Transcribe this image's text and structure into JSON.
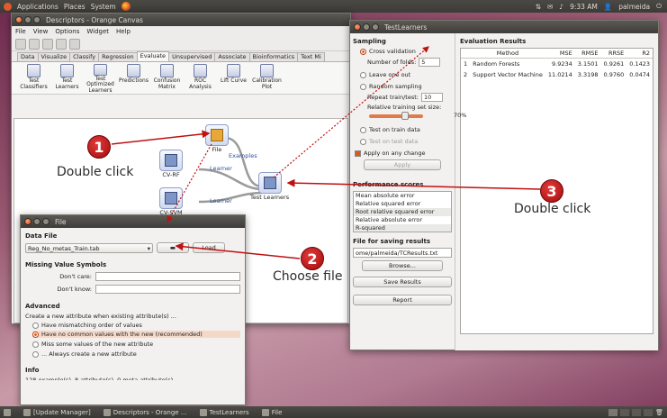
{
  "topbar": {
    "menus": [
      "Applications",
      "Places",
      "System"
    ],
    "time": "9:33 AM",
    "user": "palmeida"
  },
  "canvas_window": {
    "title": "Descriptors - Orange Canvas",
    "menus": [
      "File",
      "View",
      "Options",
      "Widget",
      "Help"
    ],
    "tabs": [
      "Data",
      "Visualize",
      "Classify",
      "Regression",
      "Evaluate",
      "Unsupervised",
      "Associate",
      "Bioinformatics",
      "Text Mi"
    ],
    "active_tab": "Evaluate",
    "widgets": [
      {
        "label": "Test Classifiers",
        "icon": "test-classifiers-icon"
      },
      {
        "label": "Test Learners",
        "icon": "test-learners-icon"
      },
      {
        "label": "Test Optimized Learners",
        "icon": "test-optimized-icon"
      },
      {
        "label": "Predictions",
        "icon": "predictions-icon"
      },
      {
        "label": "Confusion Matrix",
        "icon": "confusion-matrix-icon"
      },
      {
        "label": "ROC Analysis",
        "icon": "roc-analysis-icon"
      },
      {
        "label": "Lift Curve",
        "icon": "lift-curve-icon"
      },
      {
        "label": "Calibration Plot",
        "icon": "calibration-plot-icon"
      }
    ],
    "nodes": {
      "file": "File",
      "cvrf": "CV-RF",
      "cvsvm": "CV-SVM",
      "test_learners": "Test Learners"
    },
    "links": {
      "examples": "Examples",
      "learner1": "Learner",
      "learner2": "Learner"
    }
  },
  "testlearners": {
    "title": "TestLearners",
    "sampling_title": "Sampling",
    "cross_validation": "Cross validation",
    "number_of_folds_label": "Number of folds:",
    "number_of_folds": "5",
    "leave_one_out": "Leave one out",
    "random_sampling": "Random sampling",
    "repeat_label": "Repeat train/test:",
    "repeat_value": "10",
    "relative_size_label": "Relative training set size:",
    "relative_size_value": "70%",
    "relative_size_fraction": 0.7,
    "test_on_train": "Test on train data",
    "test_on_test": "Test on test data",
    "apply_on_change": "Apply on any change",
    "apply_button": "Apply",
    "performance_title": "Performance scores",
    "scores": [
      "Mean absolute error",
      "Relative squared error",
      "Root relative squared error",
      "Relative absolute error",
      "R-squared"
    ],
    "file_title": "File for saving results",
    "file_path": "ome/palmeida/TCResults.txt",
    "browse_button": "Browse...",
    "save_button": "Save Results",
    "report_button": "Report",
    "eval_title": "Evaluation Results",
    "columns": [
      "Method",
      "MSE",
      "RMSE",
      "RRSE",
      "R2"
    ],
    "rows": [
      {
        "idx": "1",
        "method": "Random Forests",
        "mse": "9.9234",
        "rmse": "3.1501",
        "rrse": "0.9261",
        "r2": "0.1423"
      },
      {
        "idx": "2",
        "method": "Support Vector Machine",
        "mse": "11.0214",
        "rmse": "3.3198",
        "rrse": "0.9760",
        "r2": "0.0474"
      }
    ]
  },
  "file_dialog": {
    "title": "File",
    "data_file_title": "Data File",
    "selected_file": "Reg_No_metas_Train.tab",
    "reload_button": "Load",
    "missing_title": "Missing Value Symbols",
    "dont_care": "Don't care:",
    "dont_know": "Don't know:",
    "advanced_title": "Advanced",
    "advanced_desc": "Create a new attribute when existing attribute(s) ...",
    "opts": [
      "Have mismatching order of values",
      "Have no common values with the new (recommended)",
      "Miss some values of the new attribute",
      "... Always create a new attribute"
    ],
    "info_title": "Info",
    "info_text": "128 example(s), 8 attribute(s), 0 meta attribute(s)"
  },
  "taskbar": {
    "items": [
      "[Update Manager]",
      "Descriptors - Orange ...",
      "TestLearners",
      "File"
    ]
  },
  "annotations": {
    "one": "1",
    "one_text": "Double click",
    "two": "2",
    "two_text": "Choose file",
    "three": "3",
    "three_text": "Double click"
  },
  "colors": {
    "annotation_red": "#c01010",
    "accent_orange": "#e0571d"
  }
}
